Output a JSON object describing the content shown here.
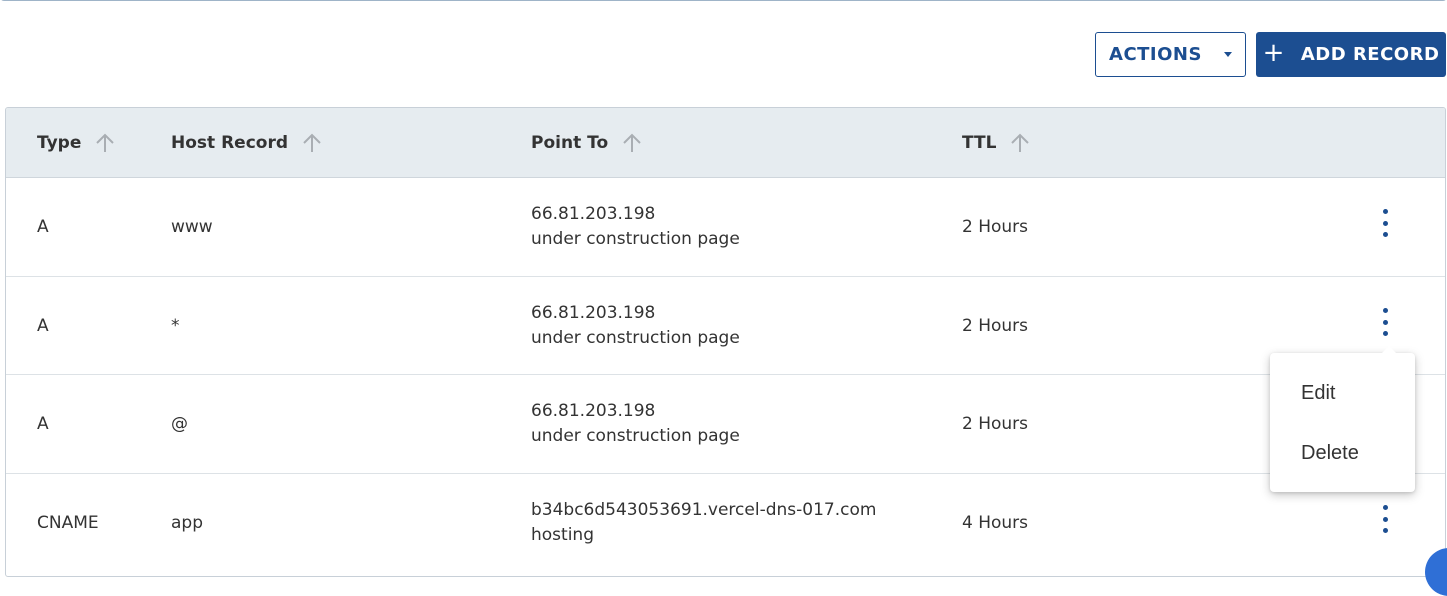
{
  "toolbar": {
    "actions_label": "ACTIONS",
    "add_record_label": "ADD RECORD"
  },
  "table": {
    "columns": [
      "Type",
      "Host Record",
      "Point To",
      "TTL"
    ],
    "rows": [
      {
        "type": "A",
        "host": "www",
        "point_to": "66.81.203.198",
        "point_to_note": "under construction page",
        "ttl": "2 Hours"
      },
      {
        "type": "A",
        "host": "*",
        "point_to": "66.81.203.198",
        "point_to_note": "under construction page",
        "ttl": "2 Hours"
      },
      {
        "type": "A",
        "host": "@",
        "point_to": "66.81.203.198",
        "point_to_note": "under construction page",
        "ttl": "2 Hours"
      },
      {
        "type": "CNAME",
        "host": "app",
        "point_to": "b34bc6d543053691.vercel-dns-017.com",
        "point_to_note": "hosting",
        "ttl": "4 Hours"
      }
    ]
  },
  "context_menu": {
    "items": [
      "Edit",
      "Delete"
    ]
  },
  "colors": {
    "primary": "#1c4e91",
    "header_bg": "#e6ecf0"
  }
}
